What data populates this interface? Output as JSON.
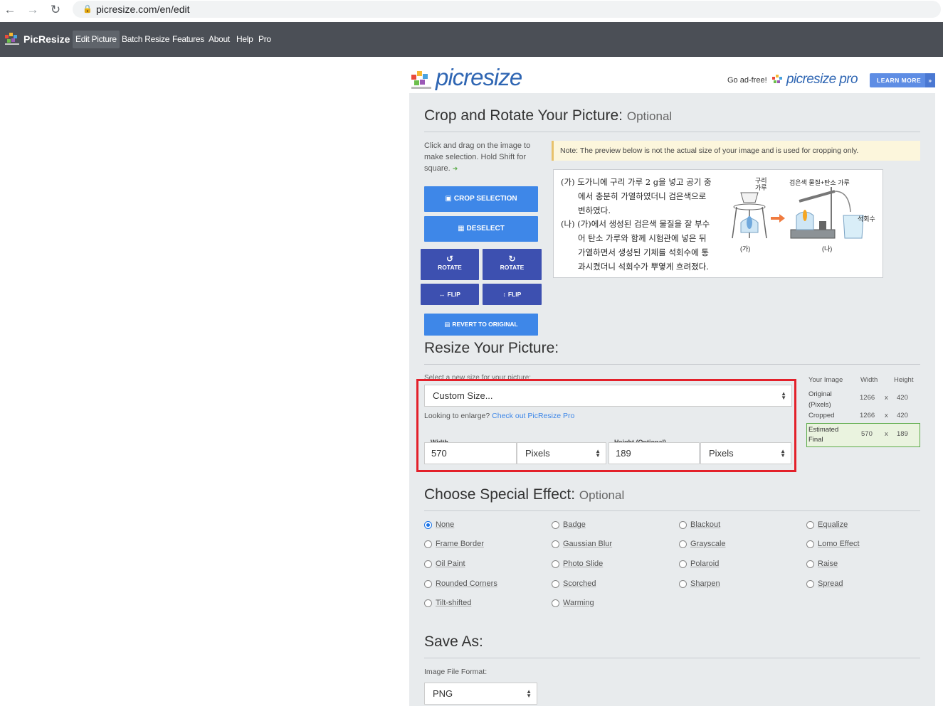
{
  "browser": {
    "url": "picresize.com/en/edit"
  },
  "nav": {
    "brand": "PicResize",
    "items": [
      {
        "label": "Edit Picture",
        "active": true
      },
      {
        "label": "Batch Resize"
      },
      {
        "label": "Features"
      },
      {
        "label": "About"
      },
      {
        "label": "Help"
      },
      {
        "label": "Pro"
      }
    ]
  },
  "header": {
    "logo_text": "picresize",
    "ad_text": "Go ad-free!",
    "pro_logo": "picresize pro",
    "learn_more": "LEARN MORE"
  },
  "crop": {
    "title": "Crop and Rotate Your Picture:",
    "optional": "Optional",
    "help": "Click and drag on the image to make selection. Hold Shift for square.",
    "note": "Note: The preview below is not the actual size of your image and is used for cropping only.",
    "buttons": {
      "crop": "CROP SELECTION",
      "deselect": "DESELECT",
      "rotate_left": "ROTATE",
      "rotate_right": "ROTATE",
      "flip_h": "FLIP",
      "flip_v": "FLIP",
      "revert": "REVERT TO ORIGINAL"
    },
    "preview": {
      "text_lines": [
        "(가) 도가니에 구리 가루 2 g을 넣고 공기 중",
        "에서 충분히 가열하였더니 검은색으로",
        "변하였다.",
        "(나) (가)에서 생성된 검은색 물질을 잘 부수",
        "어 탄소 가루와 함께 시험관에 넣은 뒤",
        "가열하면서 생성된 기체를 석회수에 통",
        "과시켰더니 석회수가 뿌옇게 흐려졌다."
      ],
      "label_copper": "구리\n가루",
      "label_black": "검은색 물질+탄소 가루",
      "label_lime": "석회수",
      "label_ga": "(가)",
      "label_na": "(나)"
    }
  },
  "resize": {
    "title": "Resize Your Picture:",
    "select_label": "Select a new size for your picture:",
    "size_select": "Custom Size...",
    "enlarge_text": "Looking to enlarge?",
    "enlarge_link": "Check out PicResize Pro",
    "width_label": "Width",
    "width_value": "570",
    "width_unit": "Pixels",
    "height_label": "Height (Optional)",
    "height_value": "189",
    "height_unit": "Pixels",
    "table": {
      "headers": [
        "Your Image",
        "Width",
        "Height"
      ],
      "rows": [
        {
          "label": "Original\n(Pixels)",
          "w": "1266",
          "x": "x",
          "h": "420"
        },
        {
          "label": "Cropped",
          "w": "1266",
          "x": "x",
          "h": "420"
        },
        {
          "label": "Estimated\nFinal",
          "w": "570",
          "x": "x",
          "h": "189"
        }
      ]
    }
  },
  "effects": {
    "title": "Choose Special Effect:",
    "optional": "Optional",
    "options": [
      {
        "label": "None",
        "checked": true
      },
      {
        "label": "Badge"
      },
      {
        "label": "Blackout"
      },
      {
        "label": "Equalize"
      },
      {
        "label": "Frame Border"
      },
      {
        "label": "Gaussian Blur"
      },
      {
        "label": "Grayscale"
      },
      {
        "label": "Lomo Effect"
      },
      {
        "label": "Oil Paint"
      },
      {
        "label": "Photo Slide"
      },
      {
        "label": "Polaroid"
      },
      {
        "label": "Raise"
      },
      {
        "label": "Rounded Corners"
      },
      {
        "label": "Scorched"
      },
      {
        "label": "Sharpen"
      },
      {
        "label": "Spread"
      },
      {
        "label": "Tilt-shifted"
      },
      {
        "label": "Warming"
      }
    ]
  },
  "save": {
    "title": "Save As:",
    "format_label": "Image File Format:",
    "format_value": "PNG"
  },
  "colors": {
    "nav_bg": "#4b4f56",
    "button_blue": "#3e87e8",
    "button_dark": "#3d50b0",
    "highlight_red": "#e3202a",
    "final_green": "#5cab4a"
  }
}
